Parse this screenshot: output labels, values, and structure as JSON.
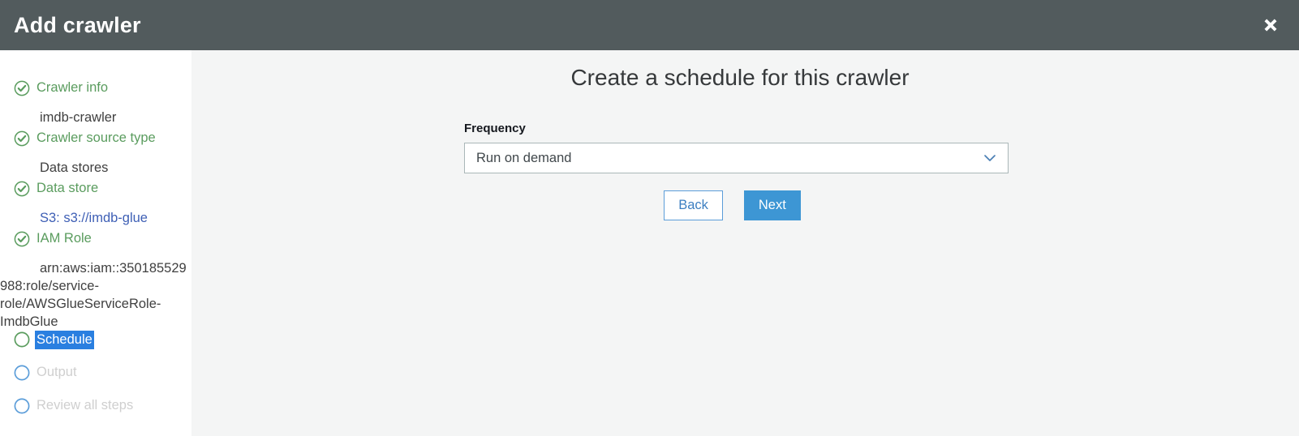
{
  "header": {
    "title": "Add crawler",
    "close_icon": "close-icon"
  },
  "sidebar": {
    "steps": [
      {
        "label": "Crawler info",
        "state": "done",
        "icon": "check-circle-icon",
        "sub": "imdb-crawler",
        "sub_type": "text"
      },
      {
        "label": "Crawler source type",
        "state": "done",
        "icon": "check-circle-icon",
        "sub": "Data stores",
        "sub_type": "text"
      },
      {
        "label": "Data store",
        "state": "done",
        "icon": "check-circle-icon",
        "sub": "S3: s3://imdb-glue",
        "sub_type": "link"
      },
      {
        "label": "IAM Role",
        "state": "done",
        "icon": "check-circle-icon",
        "sub": "arn:aws:iam::350185529988:role/service-role/AWSGlueServiceRole-ImdbGlue",
        "sub_type": "arn"
      },
      {
        "label": "Schedule",
        "state": "current",
        "icon": "empty-circle-green-icon",
        "sub": "",
        "sub_type": "none"
      },
      {
        "label": "Output",
        "state": "pending",
        "icon": "empty-circle-blue-icon",
        "sub": "",
        "sub_type": "none"
      },
      {
        "label": "Review all steps",
        "state": "pending",
        "icon": "empty-circle-blue-icon",
        "sub": "",
        "sub_type": "none"
      }
    ]
  },
  "main": {
    "page_title": "Create a schedule for this crawler",
    "frequency": {
      "label": "Frequency",
      "selected_value": "Run on demand",
      "chevron_icon": "chevron-down-icon"
    },
    "buttons": {
      "back_label": "Back",
      "next_label": "Next"
    }
  },
  "colors": {
    "header_bg": "#525b5c",
    "done_green": "#5a9c5e",
    "pending_grey": "#cfcfcf",
    "selection_blue": "#2a7fe0",
    "link_blue": "#3e5fb5",
    "primary_blue": "#3d96d4",
    "content_bg": "#f4f5f5",
    "sidebar_bg": "#ffffff"
  }
}
